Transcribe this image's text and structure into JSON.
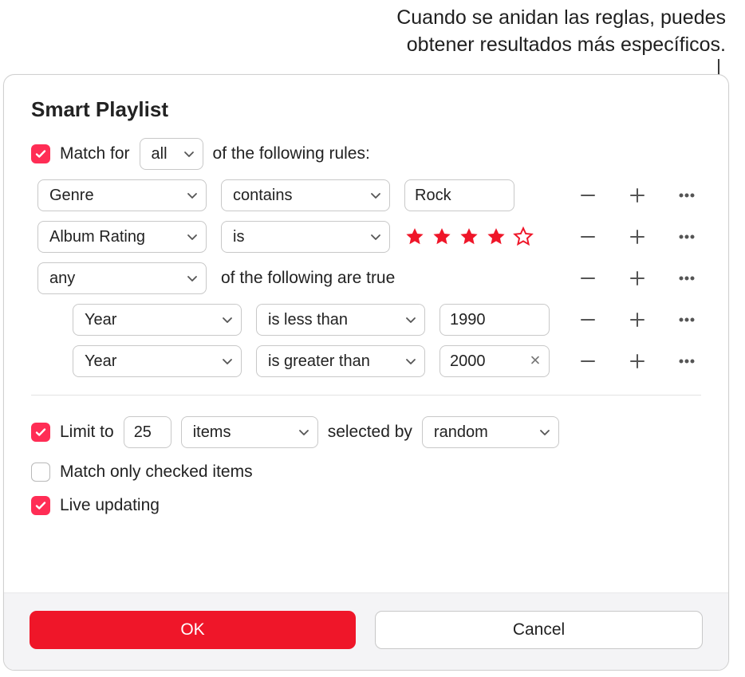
{
  "callout": {
    "line1": "Cuando se anidan las reglas, puedes",
    "line2": "obtener resultados más específicos."
  },
  "dialog": {
    "title": "Smart Playlist",
    "match": {
      "checked": true,
      "prefix": "Match  for",
      "scope": "all",
      "suffix": "of the following rules:"
    },
    "rules": [
      {
        "attr": "Genre",
        "op": "contains",
        "value": "Rock",
        "value_type": "text"
      },
      {
        "attr": "Album Rating",
        "op": "is",
        "value_type": "stars",
        "stars_filled": 4,
        "stars_total": 5
      },
      {
        "type": "group",
        "mode": "any",
        "suffix": "of the following are true",
        "children": [
          {
            "attr": "Year",
            "op": "is less than",
            "value": "1990",
            "value_type": "text",
            "clearable": false
          },
          {
            "attr": "Year",
            "op": "is greater than",
            "value": "2000",
            "value_type": "text",
            "clearable": true
          }
        ]
      }
    ],
    "limit": {
      "checked": true,
      "label": "Limit to",
      "value": "25",
      "unit": "items",
      "selected_by_label": "selected by",
      "selected_by": "random"
    },
    "match_checked_only": {
      "checked": false,
      "label": "Match only checked items"
    },
    "live_updating": {
      "checked": true,
      "label": "Live updating"
    },
    "buttons": {
      "ok": "OK",
      "cancel": "Cancel"
    }
  },
  "icons": {
    "chevron": "chevron-down-icon",
    "minus": "minus-icon",
    "plus": "plus-icon",
    "more": "more-icon",
    "clear": "close-icon",
    "check": "check-icon",
    "star_fill": "star-filled-icon",
    "star_outline": "star-outline-icon"
  }
}
